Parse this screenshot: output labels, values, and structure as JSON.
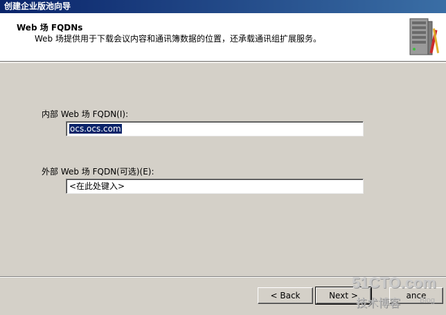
{
  "window": {
    "title": "创建企业版池向导"
  },
  "header": {
    "title": "Web 场 FQDNs",
    "description": "Web 场提供用于下载会议内容和通讯簿数据的位置，还承载通讯组扩展服务。"
  },
  "form": {
    "internal": {
      "label": "内部 Web 场 FQDN(I):",
      "value": "ocs.ocs.com"
    },
    "external": {
      "label": "外部 Web 场 FQDN(可选)(E):",
      "value": "<在此处键入>"
    }
  },
  "buttons": {
    "back": "< Back",
    "next": "Next >",
    "cancel": "ance"
  },
  "watermark": {
    "main": "51CTO.com",
    "sub": "技术博客",
    "blog": "Blog"
  },
  "colors": {
    "dialog_bg": "#d4d0c8",
    "titlebar": "#0a246a",
    "selection": "#0a246a"
  }
}
